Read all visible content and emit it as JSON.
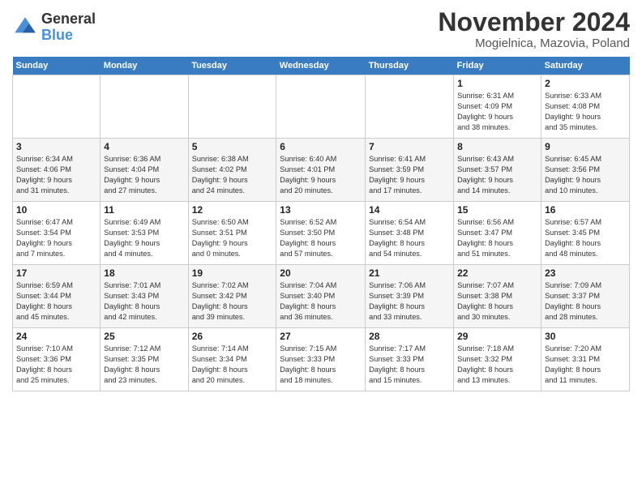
{
  "header": {
    "logo_general": "General",
    "logo_blue": "Blue",
    "month_title": "November 2024",
    "location": "Mogielnica, Mazovia, Poland"
  },
  "days_of_week": [
    "Sunday",
    "Monday",
    "Tuesday",
    "Wednesday",
    "Thursday",
    "Friday",
    "Saturday"
  ],
  "weeks": [
    [
      {
        "day": "",
        "info": ""
      },
      {
        "day": "",
        "info": ""
      },
      {
        "day": "",
        "info": ""
      },
      {
        "day": "",
        "info": ""
      },
      {
        "day": "",
        "info": ""
      },
      {
        "day": "1",
        "info": "Sunrise: 6:31 AM\nSunset: 4:09 PM\nDaylight: 9 hours\nand 38 minutes."
      },
      {
        "day": "2",
        "info": "Sunrise: 6:33 AM\nSunset: 4:08 PM\nDaylight: 9 hours\nand 35 minutes."
      }
    ],
    [
      {
        "day": "3",
        "info": "Sunrise: 6:34 AM\nSunset: 4:06 PM\nDaylight: 9 hours\nand 31 minutes."
      },
      {
        "day": "4",
        "info": "Sunrise: 6:36 AM\nSunset: 4:04 PM\nDaylight: 9 hours\nand 27 minutes."
      },
      {
        "day": "5",
        "info": "Sunrise: 6:38 AM\nSunset: 4:02 PM\nDaylight: 9 hours\nand 24 minutes."
      },
      {
        "day": "6",
        "info": "Sunrise: 6:40 AM\nSunset: 4:01 PM\nDaylight: 9 hours\nand 20 minutes."
      },
      {
        "day": "7",
        "info": "Sunrise: 6:41 AM\nSunset: 3:59 PM\nDaylight: 9 hours\nand 17 minutes."
      },
      {
        "day": "8",
        "info": "Sunrise: 6:43 AM\nSunset: 3:57 PM\nDaylight: 9 hours\nand 14 minutes."
      },
      {
        "day": "9",
        "info": "Sunrise: 6:45 AM\nSunset: 3:56 PM\nDaylight: 9 hours\nand 10 minutes."
      }
    ],
    [
      {
        "day": "10",
        "info": "Sunrise: 6:47 AM\nSunset: 3:54 PM\nDaylight: 9 hours\nand 7 minutes."
      },
      {
        "day": "11",
        "info": "Sunrise: 6:49 AM\nSunset: 3:53 PM\nDaylight: 9 hours\nand 4 minutes."
      },
      {
        "day": "12",
        "info": "Sunrise: 6:50 AM\nSunset: 3:51 PM\nDaylight: 9 hours\nand 0 minutes."
      },
      {
        "day": "13",
        "info": "Sunrise: 6:52 AM\nSunset: 3:50 PM\nDaylight: 8 hours\nand 57 minutes."
      },
      {
        "day": "14",
        "info": "Sunrise: 6:54 AM\nSunset: 3:48 PM\nDaylight: 8 hours\nand 54 minutes."
      },
      {
        "day": "15",
        "info": "Sunrise: 6:56 AM\nSunset: 3:47 PM\nDaylight: 8 hours\nand 51 minutes."
      },
      {
        "day": "16",
        "info": "Sunrise: 6:57 AM\nSunset: 3:45 PM\nDaylight: 8 hours\nand 48 minutes."
      }
    ],
    [
      {
        "day": "17",
        "info": "Sunrise: 6:59 AM\nSunset: 3:44 PM\nDaylight: 8 hours\nand 45 minutes."
      },
      {
        "day": "18",
        "info": "Sunrise: 7:01 AM\nSunset: 3:43 PM\nDaylight: 8 hours\nand 42 minutes."
      },
      {
        "day": "19",
        "info": "Sunrise: 7:02 AM\nSunset: 3:42 PM\nDaylight: 8 hours\nand 39 minutes."
      },
      {
        "day": "20",
        "info": "Sunrise: 7:04 AM\nSunset: 3:40 PM\nDaylight: 8 hours\nand 36 minutes."
      },
      {
        "day": "21",
        "info": "Sunrise: 7:06 AM\nSunset: 3:39 PM\nDaylight: 8 hours\nand 33 minutes."
      },
      {
        "day": "22",
        "info": "Sunrise: 7:07 AM\nSunset: 3:38 PM\nDaylight: 8 hours\nand 30 minutes."
      },
      {
        "day": "23",
        "info": "Sunrise: 7:09 AM\nSunset: 3:37 PM\nDaylight: 8 hours\nand 28 minutes."
      }
    ],
    [
      {
        "day": "24",
        "info": "Sunrise: 7:10 AM\nSunset: 3:36 PM\nDaylight: 8 hours\nand 25 minutes."
      },
      {
        "day": "25",
        "info": "Sunrise: 7:12 AM\nSunset: 3:35 PM\nDaylight: 8 hours\nand 23 minutes."
      },
      {
        "day": "26",
        "info": "Sunrise: 7:14 AM\nSunset: 3:34 PM\nDaylight: 8 hours\nand 20 minutes."
      },
      {
        "day": "27",
        "info": "Sunrise: 7:15 AM\nSunset: 3:33 PM\nDaylight: 8 hours\nand 18 minutes."
      },
      {
        "day": "28",
        "info": "Sunrise: 7:17 AM\nSunset: 3:33 PM\nDaylight: 8 hours\nand 15 minutes."
      },
      {
        "day": "29",
        "info": "Sunrise: 7:18 AM\nSunset: 3:32 PM\nDaylight: 8 hours\nand 13 minutes."
      },
      {
        "day": "30",
        "info": "Sunrise: 7:20 AM\nSunset: 3:31 PM\nDaylight: 8 hours\nand 11 minutes."
      }
    ]
  ]
}
